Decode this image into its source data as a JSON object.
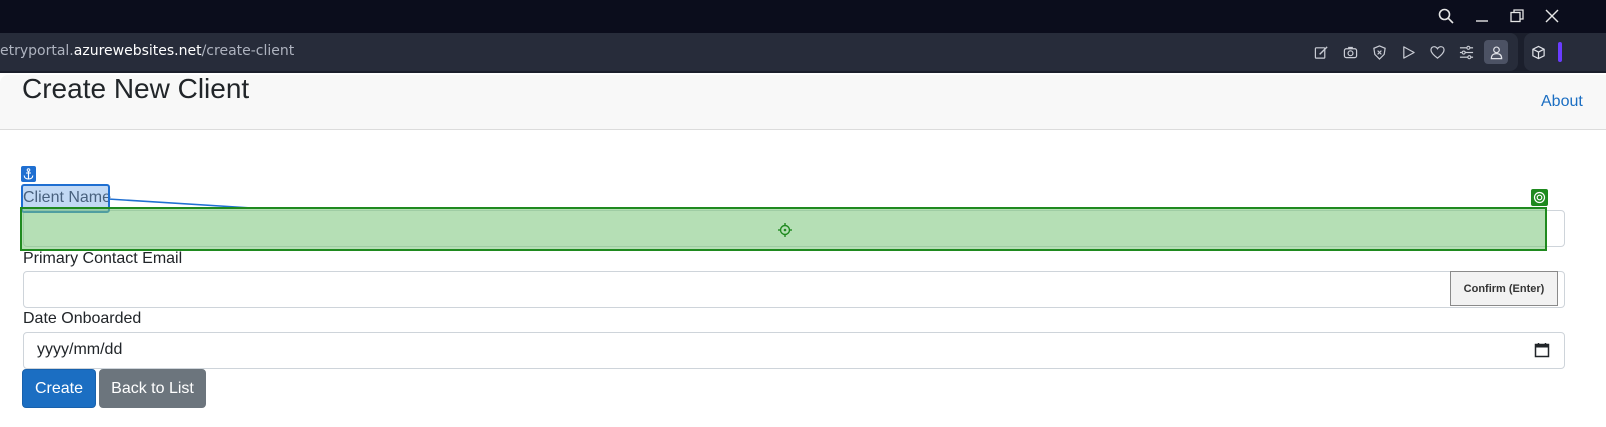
{
  "browser": {
    "url_prefix": "etryportal.",
    "url_host": "azurewebsites.net",
    "url_path": "/create-client",
    "window_controls": [
      "search-icon",
      "minimize-icon",
      "restore-icon",
      "close-icon"
    ],
    "toolbar_icons": [
      "edit-icon",
      "camera-icon",
      "shield-icon",
      "play-icon",
      "heart-icon",
      "sliders-icon",
      "profile-icon",
      "extension-cube-icon"
    ]
  },
  "nav": {
    "about_label": "About"
  },
  "form": {
    "title": "Create New Client",
    "client_name_label": "Client Name",
    "client_name_value": "",
    "email_label": "Primary Contact Email",
    "email_value": "",
    "date_label": "Date Onboarded",
    "date_placeholder": "yyyy/mm/dd",
    "create_label": "Create",
    "back_label": "Back to List"
  },
  "overlay": {
    "confirm_label": "Confirm (Enter)",
    "anchor_icon": "anchor-icon",
    "target_icon": "target-icon",
    "crosshair_icon": "crosshair-icon",
    "label_highlight_color": "#1f6fd1",
    "target_highlight_color": "#1f8a1f"
  },
  "colors": {
    "primary": "#1b6ec2",
    "secondary": "#6c757d",
    "titlebar": "#0b0d1c",
    "urlbar": "#272c3a"
  }
}
